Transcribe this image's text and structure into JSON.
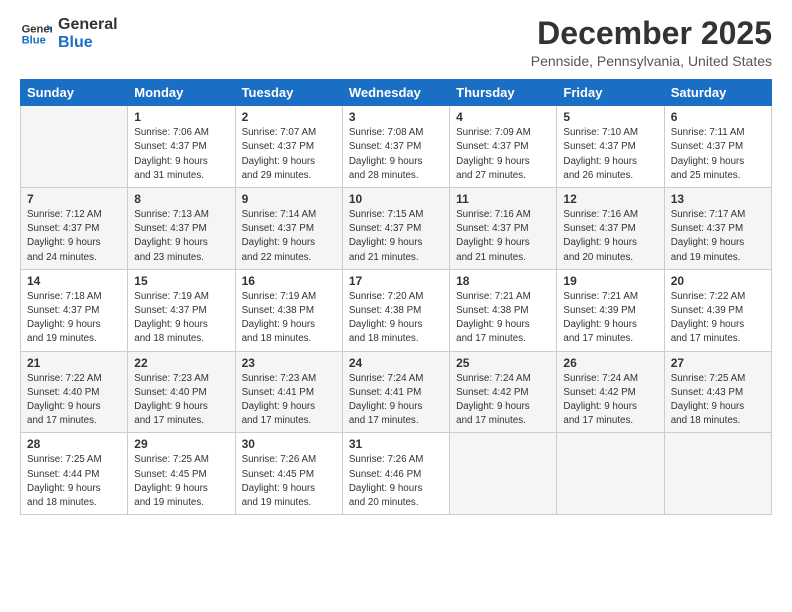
{
  "logo": {
    "line1": "General",
    "line2": "Blue"
  },
  "title": "December 2025",
  "location": "Pennside, Pennsylvania, United States",
  "days_of_week": [
    "Sunday",
    "Monday",
    "Tuesday",
    "Wednesday",
    "Thursday",
    "Friday",
    "Saturday"
  ],
  "weeks": [
    [
      {
        "day": "",
        "info": ""
      },
      {
        "day": "1",
        "info": "Sunrise: 7:06 AM\nSunset: 4:37 PM\nDaylight: 9 hours\nand 31 minutes."
      },
      {
        "day": "2",
        "info": "Sunrise: 7:07 AM\nSunset: 4:37 PM\nDaylight: 9 hours\nand 29 minutes."
      },
      {
        "day": "3",
        "info": "Sunrise: 7:08 AM\nSunset: 4:37 PM\nDaylight: 9 hours\nand 28 minutes."
      },
      {
        "day": "4",
        "info": "Sunrise: 7:09 AM\nSunset: 4:37 PM\nDaylight: 9 hours\nand 27 minutes."
      },
      {
        "day": "5",
        "info": "Sunrise: 7:10 AM\nSunset: 4:37 PM\nDaylight: 9 hours\nand 26 minutes."
      },
      {
        "day": "6",
        "info": "Sunrise: 7:11 AM\nSunset: 4:37 PM\nDaylight: 9 hours\nand 25 minutes."
      }
    ],
    [
      {
        "day": "7",
        "info": "Sunrise: 7:12 AM\nSunset: 4:37 PM\nDaylight: 9 hours\nand 24 minutes."
      },
      {
        "day": "8",
        "info": "Sunrise: 7:13 AM\nSunset: 4:37 PM\nDaylight: 9 hours\nand 23 minutes."
      },
      {
        "day": "9",
        "info": "Sunrise: 7:14 AM\nSunset: 4:37 PM\nDaylight: 9 hours\nand 22 minutes."
      },
      {
        "day": "10",
        "info": "Sunrise: 7:15 AM\nSunset: 4:37 PM\nDaylight: 9 hours\nand 21 minutes."
      },
      {
        "day": "11",
        "info": "Sunrise: 7:16 AM\nSunset: 4:37 PM\nDaylight: 9 hours\nand 21 minutes."
      },
      {
        "day": "12",
        "info": "Sunrise: 7:16 AM\nSunset: 4:37 PM\nDaylight: 9 hours\nand 20 minutes."
      },
      {
        "day": "13",
        "info": "Sunrise: 7:17 AM\nSunset: 4:37 PM\nDaylight: 9 hours\nand 19 minutes."
      }
    ],
    [
      {
        "day": "14",
        "info": "Sunrise: 7:18 AM\nSunset: 4:37 PM\nDaylight: 9 hours\nand 19 minutes."
      },
      {
        "day": "15",
        "info": "Sunrise: 7:19 AM\nSunset: 4:37 PM\nDaylight: 9 hours\nand 18 minutes."
      },
      {
        "day": "16",
        "info": "Sunrise: 7:19 AM\nSunset: 4:38 PM\nDaylight: 9 hours\nand 18 minutes."
      },
      {
        "day": "17",
        "info": "Sunrise: 7:20 AM\nSunset: 4:38 PM\nDaylight: 9 hours\nand 18 minutes."
      },
      {
        "day": "18",
        "info": "Sunrise: 7:21 AM\nSunset: 4:38 PM\nDaylight: 9 hours\nand 17 minutes."
      },
      {
        "day": "19",
        "info": "Sunrise: 7:21 AM\nSunset: 4:39 PM\nDaylight: 9 hours\nand 17 minutes."
      },
      {
        "day": "20",
        "info": "Sunrise: 7:22 AM\nSunset: 4:39 PM\nDaylight: 9 hours\nand 17 minutes."
      }
    ],
    [
      {
        "day": "21",
        "info": "Sunrise: 7:22 AM\nSunset: 4:40 PM\nDaylight: 9 hours\nand 17 minutes."
      },
      {
        "day": "22",
        "info": "Sunrise: 7:23 AM\nSunset: 4:40 PM\nDaylight: 9 hours\nand 17 minutes."
      },
      {
        "day": "23",
        "info": "Sunrise: 7:23 AM\nSunset: 4:41 PM\nDaylight: 9 hours\nand 17 minutes."
      },
      {
        "day": "24",
        "info": "Sunrise: 7:24 AM\nSunset: 4:41 PM\nDaylight: 9 hours\nand 17 minutes."
      },
      {
        "day": "25",
        "info": "Sunrise: 7:24 AM\nSunset: 4:42 PM\nDaylight: 9 hours\nand 17 minutes."
      },
      {
        "day": "26",
        "info": "Sunrise: 7:24 AM\nSunset: 4:42 PM\nDaylight: 9 hours\nand 17 minutes."
      },
      {
        "day": "27",
        "info": "Sunrise: 7:25 AM\nSunset: 4:43 PM\nDaylight: 9 hours\nand 18 minutes."
      }
    ],
    [
      {
        "day": "28",
        "info": "Sunrise: 7:25 AM\nSunset: 4:44 PM\nDaylight: 9 hours\nand 18 minutes."
      },
      {
        "day": "29",
        "info": "Sunrise: 7:25 AM\nSunset: 4:45 PM\nDaylight: 9 hours\nand 19 minutes."
      },
      {
        "day": "30",
        "info": "Sunrise: 7:26 AM\nSunset: 4:45 PM\nDaylight: 9 hours\nand 19 minutes."
      },
      {
        "day": "31",
        "info": "Sunrise: 7:26 AM\nSunset: 4:46 PM\nDaylight: 9 hours\nand 20 minutes."
      },
      {
        "day": "",
        "info": ""
      },
      {
        "day": "",
        "info": ""
      },
      {
        "day": "",
        "info": ""
      }
    ]
  ]
}
